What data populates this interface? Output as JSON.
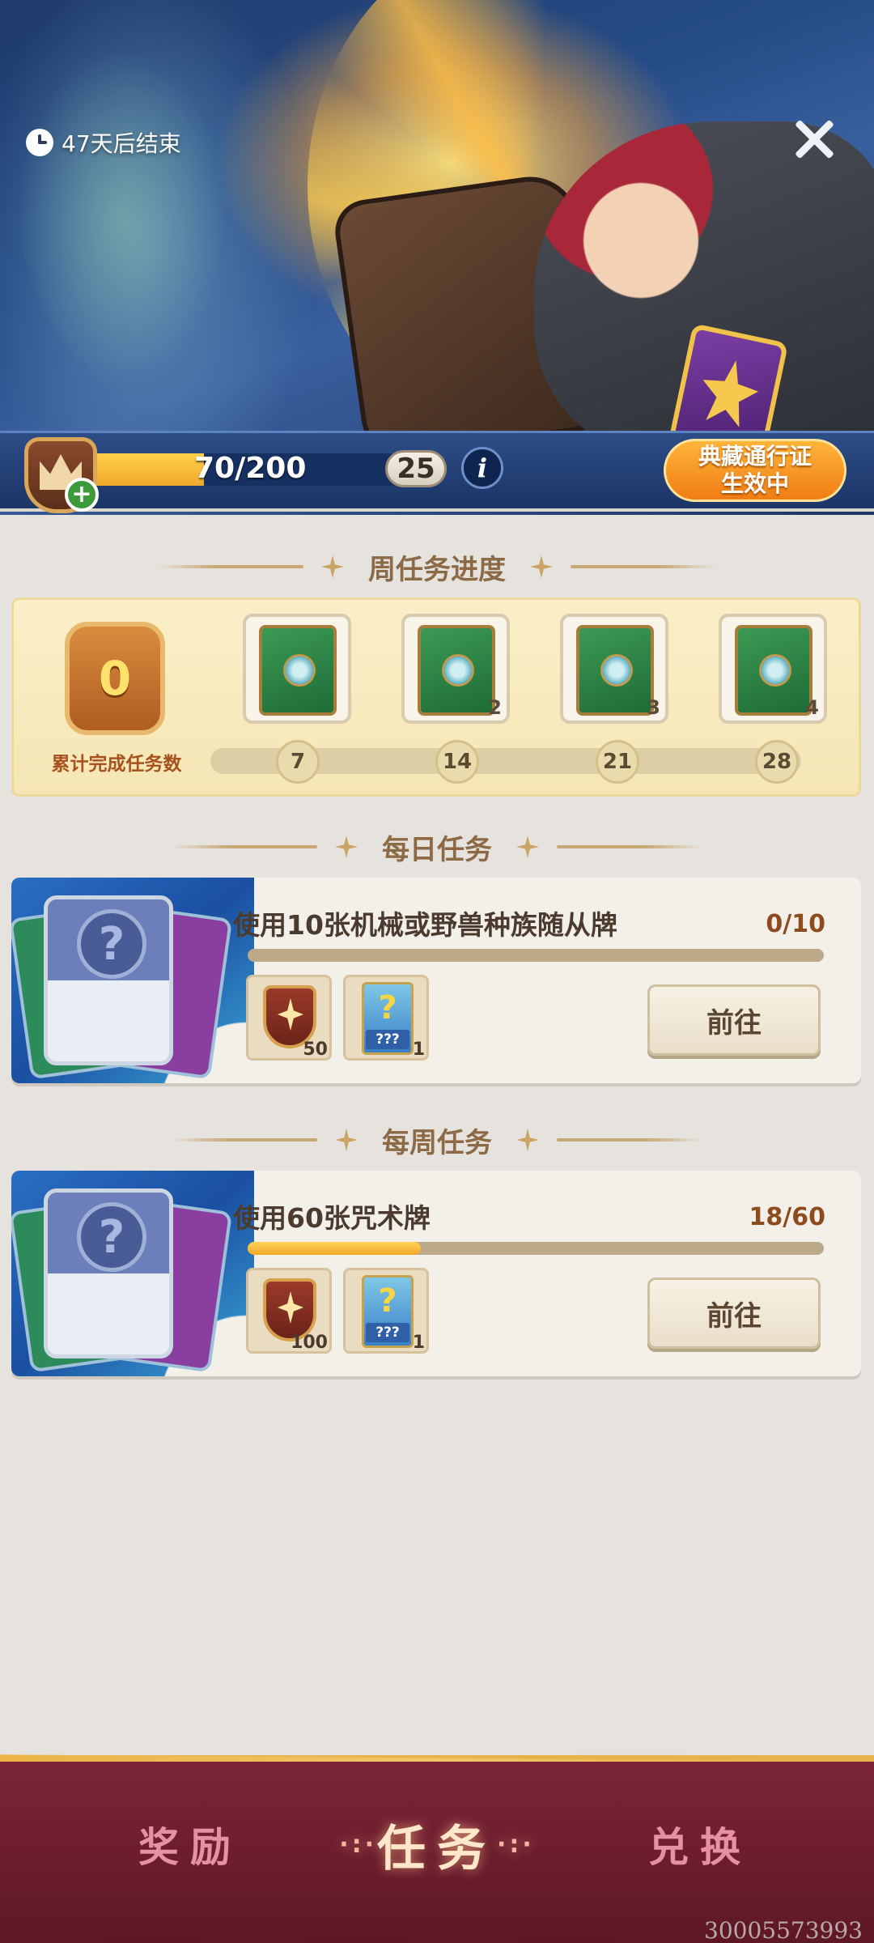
{
  "hero": {
    "timer_text": "47天后结束",
    "close_icon": "close-icon"
  },
  "level": {
    "xp_text": "70/200",
    "xp_progress": 0.35,
    "level": "25",
    "info_label": "i",
    "pass_line1": "典藏通行证",
    "pass_line2": "生效中"
  },
  "weekly_progress": {
    "title": "周任务进度",
    "completed_count": "0",
    "completed_label": "累计完成任务数",
    "chests": [
      {
        "count": ""
      },
      {
        "count": "2"
      },
      {
        "count": "3"
      },
      {
        "count": "4"
      }
    ],
    "milestones": [
      "7",
      "14",
      "21",
      "28"
    ]
  },
  "daily": {
    "title": "每日任务",
    "quest": {
      "name": "使用10张机械或野兽种族随从牌",
      "progress_text": "0/10",
      "progress": 0,
      "rewards": [
        {
          "icon": "shield-xp-icon",
          "qty": "50"
        },
        {
          "icon": "mystery-card-icon",
          "qty": "1"
        }
      ],
      "button": "前往"
    }
  },
  "weekly": {
    "title": "每周任务",
    "quest": {
      "name": "使用60张咒术牌",
      "progress_text": "18/60",
      "progress": 0.3,
      "rewards": [
        {
          "icon": "shield-xp-icon",
          "qty": "100"
        },
        {
          "icon": "mystery-card-icon",
          "qty": "1"
        }
      ],
      "button": "前往"
    }
  },
  "nav": {
    "rewards": "奖励",
    "tasks": "任务",
    "exchange": "兑换",
    "dots_left": "·:·",
    "dots_right": "·:·"
  },
  "uid": "30005573993",
  "colors": {
    "accent_orange": "#f07d15",
    "xp_yellow": "#ffcf4a",
    "nav_bg": "#7b2536",
    "progress_text": "#8e4b1e"
  }
}
